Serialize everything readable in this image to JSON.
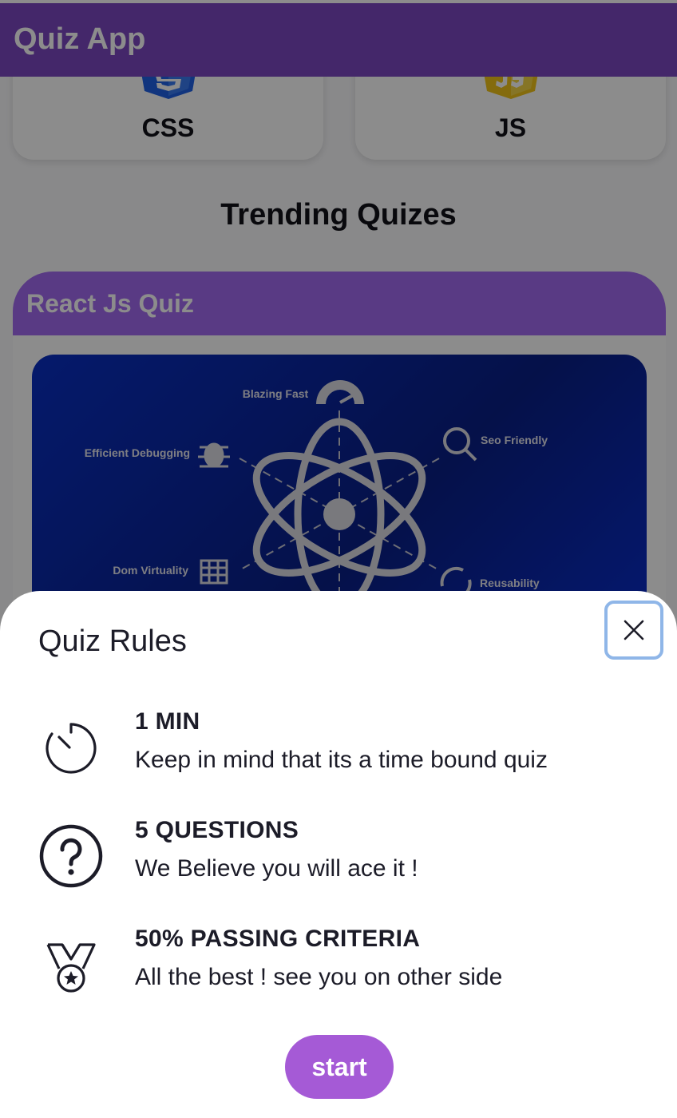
{
  "app": {
    "title": "Quiz App"
  },
  "categories": [
    {
      "label": "CSS",
      "icon": "css3-logo-icon",
      "color": "#2062e5"
    },
    {
      "label": "JS",
      "icon": "js-logo-icon",
      "color": "#f0c419"
    }
  ],
  "section": {
    "title": "Trending Quizes"
  },
  "quiz_card": {
    "title": "React Js Quiz",
    "banner_labels": {
      "blazing_fast": "Blazing Fast",
      "seo_friendly": "Seo Friendly",
      "efficient_debugging": "Efficient Debugging",
      "dom_virtuality": "Dom Virtuality",
      "reusability": "Reusability"
    }
  },
  "rules_sheet": {
    "title": "Quiz Rules",
    "close_icon": "close-icon",
    "rules": [
      {
        "icon": "timer-icon",
        "heading": "1 MIN",
        "description": "Keep in mind that its a time bound quiz"
      },
      {
        "icon": "question-circle-icon",
        "heading": "5 QUESTIONS",
        "description": "We Believe you will ace it !"
      },
      {
        "icon": "medal-icon",
        "heading": "50% PASSING CRITERIA",
        "description": "All the best ! see you on other side"
      }
    ],
    "start_label": "start"
  },
  "colors": {
    "appbar": "#7c47c2",
    "card_header": "#a36bf0",
    "start_button": "#a55ad6",
    "close_focus_ring": "#8fb6e8"
  }
}
